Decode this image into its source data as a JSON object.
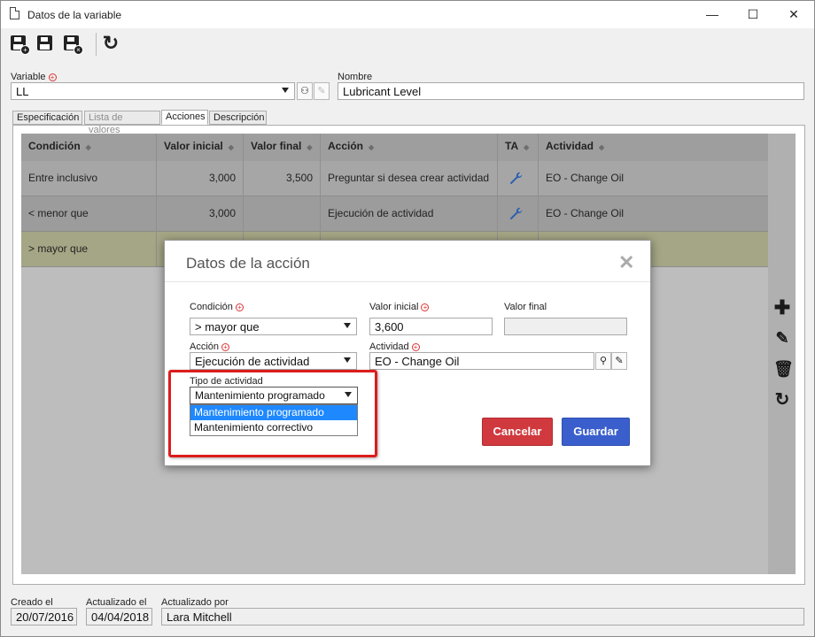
{
  "window": {
    "title": "Datos de la variable",
    "minimize": "—",
    "maximize": "☐",
    "close": "✕"
  },
  "form": {
    "variable_label": "Variable",
    "variable_value": "LL",
    "nombre_label": "Nombre",
    "nombre_value": "Lubricant Level"
  },
  "tabs": [
    {
      "label": "Especificación",
      "state": "normal"
    },
    {
      "label": "Lista de valores",
      "state": "disabled"
    },
    {
      "label": "Acciones",
      "state": "active"
    },
    {
      "label": "Descripción",
      "state": "normal"
    }
  ],
  "grid": {
    "columns": [
      "Condición",
      "Valor inicial",
      "Valor final",
      "Acción",
      "TA",
      "Actividad"
    ],
    "rows": [
      {
        "condicion": "Entre inclusivo",
        "valor_inicial": "3,000",
        "valor_final": "3,500",
        "accion": "Preguntar si desea crear actividad",
        "ta": "wrench-icon",
        "actividad": "EO - Change Oil"
      },
      {
        "condicion": "< menor que",
        "valor_inicial": "3,000",
        "valor_final": "",
        "accion": "Ejecución de actividad",
        "ta": "wrench-icon",
        "actividad": "EO - Change Oil"
      },
      {
        "condicion": "> mayor que",
        "valor_inicial": "",
        "valor_final": "",
        "accion": "",
        "ta": "",
        "actividad": ""
      }
    ]
  },
  "modal": {
    "title": "Datos de la acción",
    "condicion_label": "Condición",
    "condicion_value": "> mayor que",
    "valor_inicial_label": "Valor inicial",
    "valor_inicial_value": "3,600",
    "valor_final_label": "Valor final",
    "valor_final_value": "",
    "accion_label": "Acción",
    "accion_value": "Ejecución de actividad",
    "actividad_label": "Actividad",
    "actividad_value": "EO - Change Oil",
    "tipo_label": "Tipo de actividad",
    "tipo_value": "Mantenimiento programado",
    "tipo_options": [
      "Mantenimiento programado",
      "Mantenimiento correctivo"
    ],
    "cancel_label": "Cancelar",
    "save_label": "Guardar"
  },
  "footer": {
    "creado_label": "Creado el",
    "creado_value": "20/07/2016",
    "actualizado_label": "Actualizado el",
    "actualizado_value": "04/04/2018",
    "actualizado_por_label": "Actualizado por",
    "actualizado_por_value": "Lara Mitchell"
  },
  "colors": {
    "cancel": "#d0393e",
    "save": "#3a5fcd",
    "highlight_box": "#dd1c1c",
    "selected_option": "#1e88ff",
    "required": "#dd3333"
  }
}
